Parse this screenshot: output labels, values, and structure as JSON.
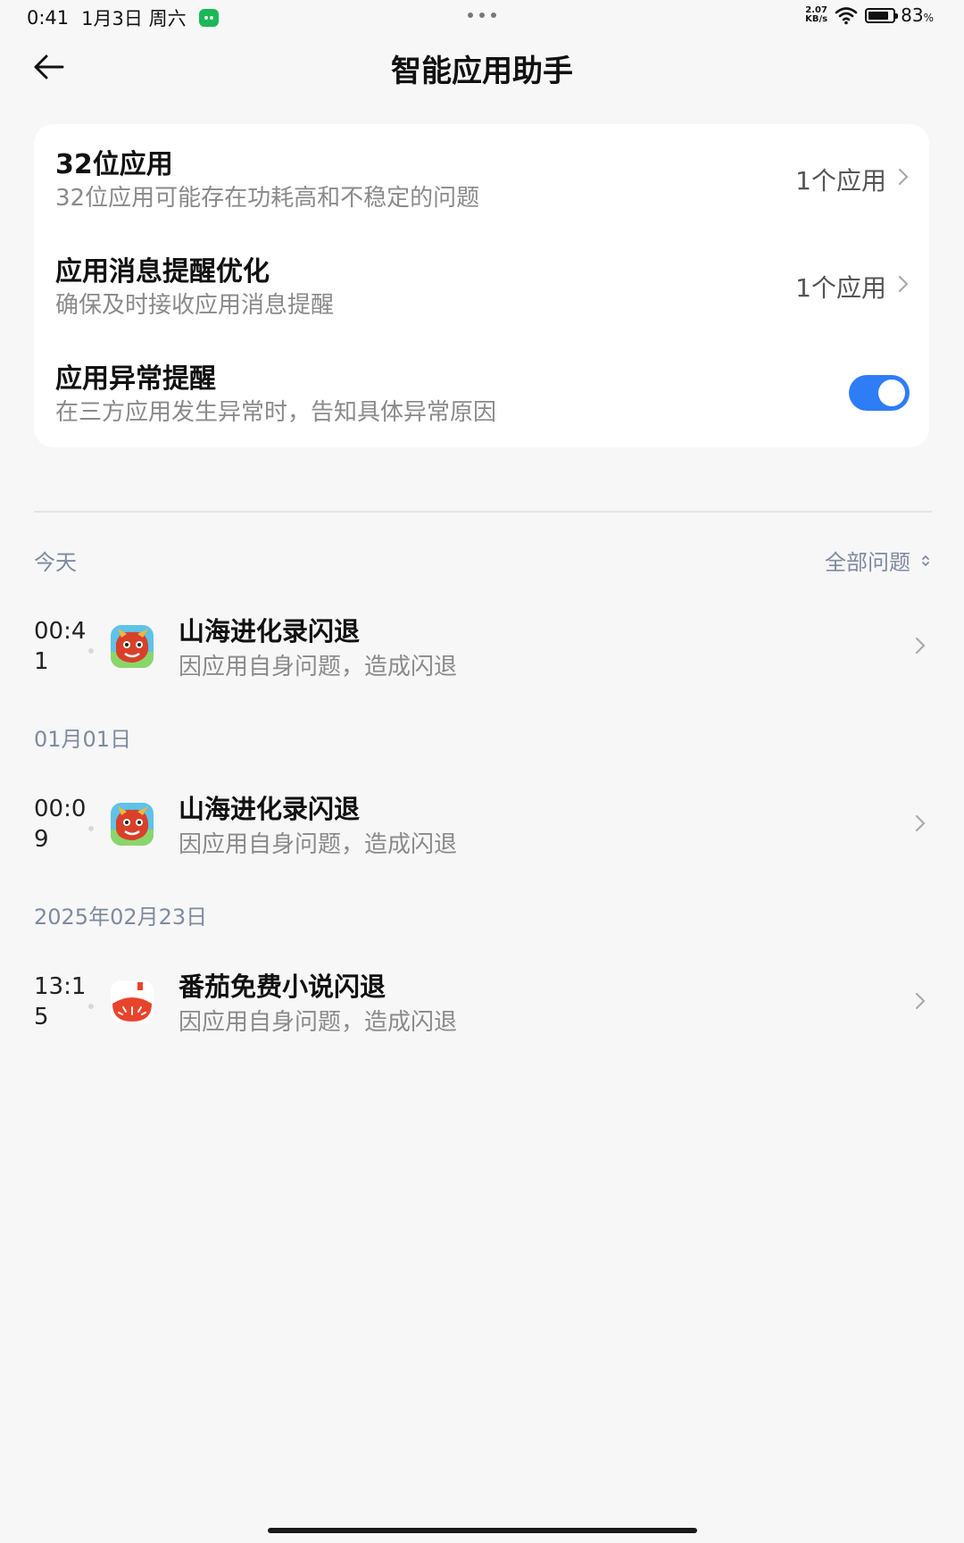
{
  "status_bar": {
    "time": "0:41",
    "date": "1月3日 周六",
    "net_speed_value": "2.07",
    "net_speed_unit": "KB/s",
    "battery_percent": "83",
    "battery_unit": "%",
    "battery_level": 0.83
  },
  "header": {
    "title": "智能应用助手"
  },
  "settings": [
    {
      "title": "32位应用",
      "subtitle": "32位应用可能存在功耗高和不稳定的问题",
      "value": "1个应用"
    },
    {
      "title": "应用消息提醒优化",
      "subtitle": "确保及时接收应用消息提醒",
      "value": "1个应用"
    },
    {
      "title": "应用异常提醒",
      "subtitle": "在三方应用发生异常时，告知具体异常原因",
      "toggle_on": true
    }
  ],
  "history": {
    "filter_label": "全部问题",
    "groups": [
      {
        "date": "今天",
        "items": [
          {
            "time": "00:41",
            "title": "山海进化录闪退",
            "subtitle": "因应用自身问题，造成闪退",
            "icon": "game-dragon-icon"
          }
        ]
      },
      {
        "date": "01月01日",
        "items": [
          {
            "time": "00:09",
            "title": "山海进化录闪退",
            "subtitle": "因应用自身问题，造成闪退",
            "icon": "game-dragon-icon"
          }
        ]
      },
      {
        "date": "2025年02月23日",
        "items": [
          {
            "time": "13:15",
            "title": "番茄免费小说闪退",
            "subtitle": "因应用自身问题，造成闪退",
            "icon": "tomato-novel-icon"
          }
        ]
      }
    ]
  },
  "colors": {
    "accent": "#2e7cf6",
    "section_label": "#7f8aa0",
    "background": "#f7f7f7"
  }
}
